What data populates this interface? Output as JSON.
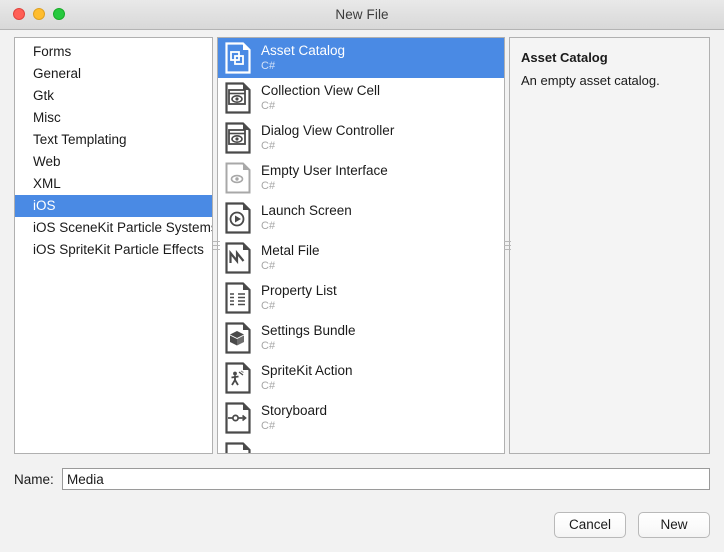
{
  "window": {
    "title": "New File",
    "traffic_lights": [
      {
        "name": "close-button",
        "color": "#ff5f56"
      },
      {
        "name": "minimize-button",
        "color": "#ffbd2e"
      },
      {
        "name": "maximize-button",
        "color": "#27c93f"
      }
    ]
  },
  "accent_color": "#4a8ae4",
  "categories": {
    "selected": "iOS",
    "items": [
      {
        "label": "Forms"
      },
      {
        "label": "General"
      },
      {
        "label": "Gtk"
      },
      {
        "label": "Misc"
      },
      {
        "label": "Text Templating"
      },
      {
        "label": "Web"
      },
      {
        "label": "XML"
      },
      {
        "label": "iOS"
      },
      {
        "label": "iOS SceneKit Particle Systems"
      },
      {
        "label": "iOS SpriteKit Particle Effects"
      }
    ]
  },
  "templates": {
    "selected": "Asset Catalog",
    "items": [
      {
        "name": "Asset Catalog",
        "language": "C#",
        "icon": "asset-catalog-icon"
      },
      {
        "name": "Collection View Cell",
        "language": "C#",
        "icon": "collection-view-cell-icon"
      },
      {
        "name": "Dialog View Controller",
        "language": "C#",
        "icon": "dialog-view-controller-icon"
      },
      {
        "name": "Empty User Interface",
        "language": "C#",
        "icon": "empty-user-interface-icon"
      },
      {
        "name": "Launch Screen",
        "language": "C#",
        "icon": "launch-screen-icon"
      },
      {
        "name": "Metal File",
        "language": "C#",
        "icon": "metal-file-icon"
      },
      {
        "name": "Property List",
        "language": "C#",
        "icon": "property-list-icon"
      },
      {
        "name": "Settings Bundle",
        "language": "C#",
        "icon": "settings-bundle-icon"
      },
      {
        "name": "SpriteKit Action",
        "language": "C#",
        "icon": "spritekit-action-icon"
      },
      {
        "name": "Storyboard",
        "language": "C#",
        "icon": "storyboard-icon"
      }
    ]
  },
  "detail": {
    "title": "Asset Catalog",
    "description": "An empty asset catalog."
  },
  "name_field": {
    "label": "Name:",
    "value": "Media",
    "placeholder": ""
  },
  "buttons": {
    "cancel_label": "Cancel",
    "new_label": "New"
  }
}
